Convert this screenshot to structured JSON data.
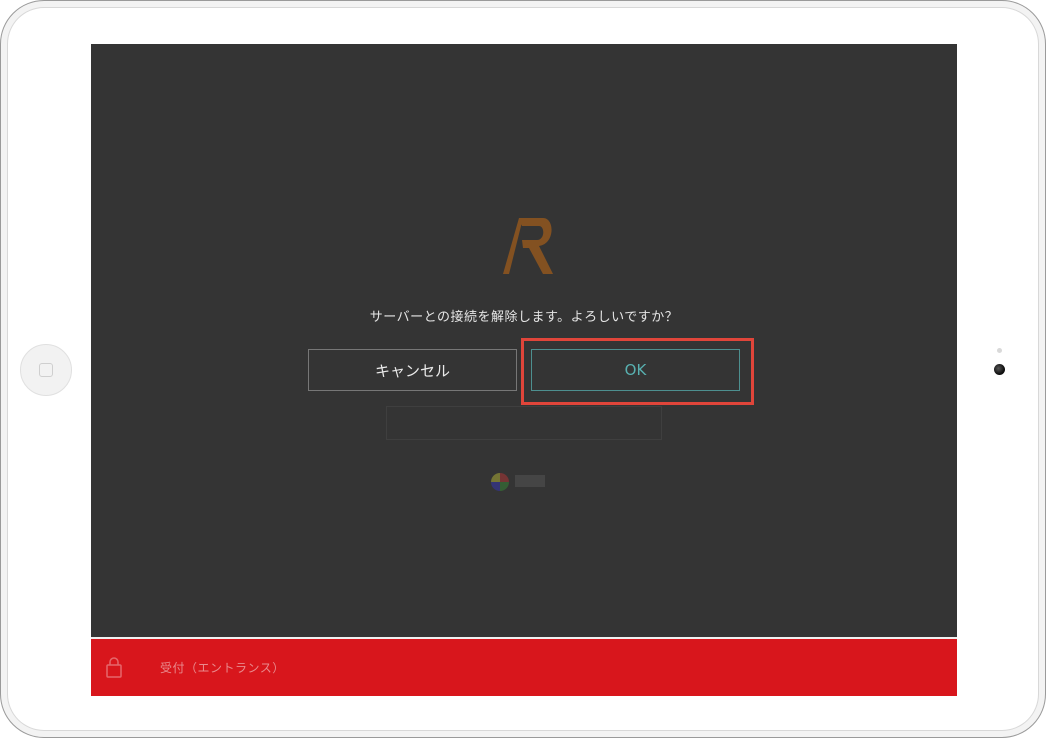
{
  "dialog": {
    "message": "サーバーとの接続を解除します。よろしいですか？",
    "cancel_label": "キャンセル",
    "ok_label": "OK"
  },
  "footer": {
    "label": "受付（エントランス）"
  },
  "colors": {
    "screen_background": "#343434",
    "footer_background": "#d8161c",
    "ok_accent": "#58b0b0",
    "highlight": "#e0453a"
  },
  "icons": {
    "logo": "r-logo-icon",
    "lock": "lock-icon"
  }
}
